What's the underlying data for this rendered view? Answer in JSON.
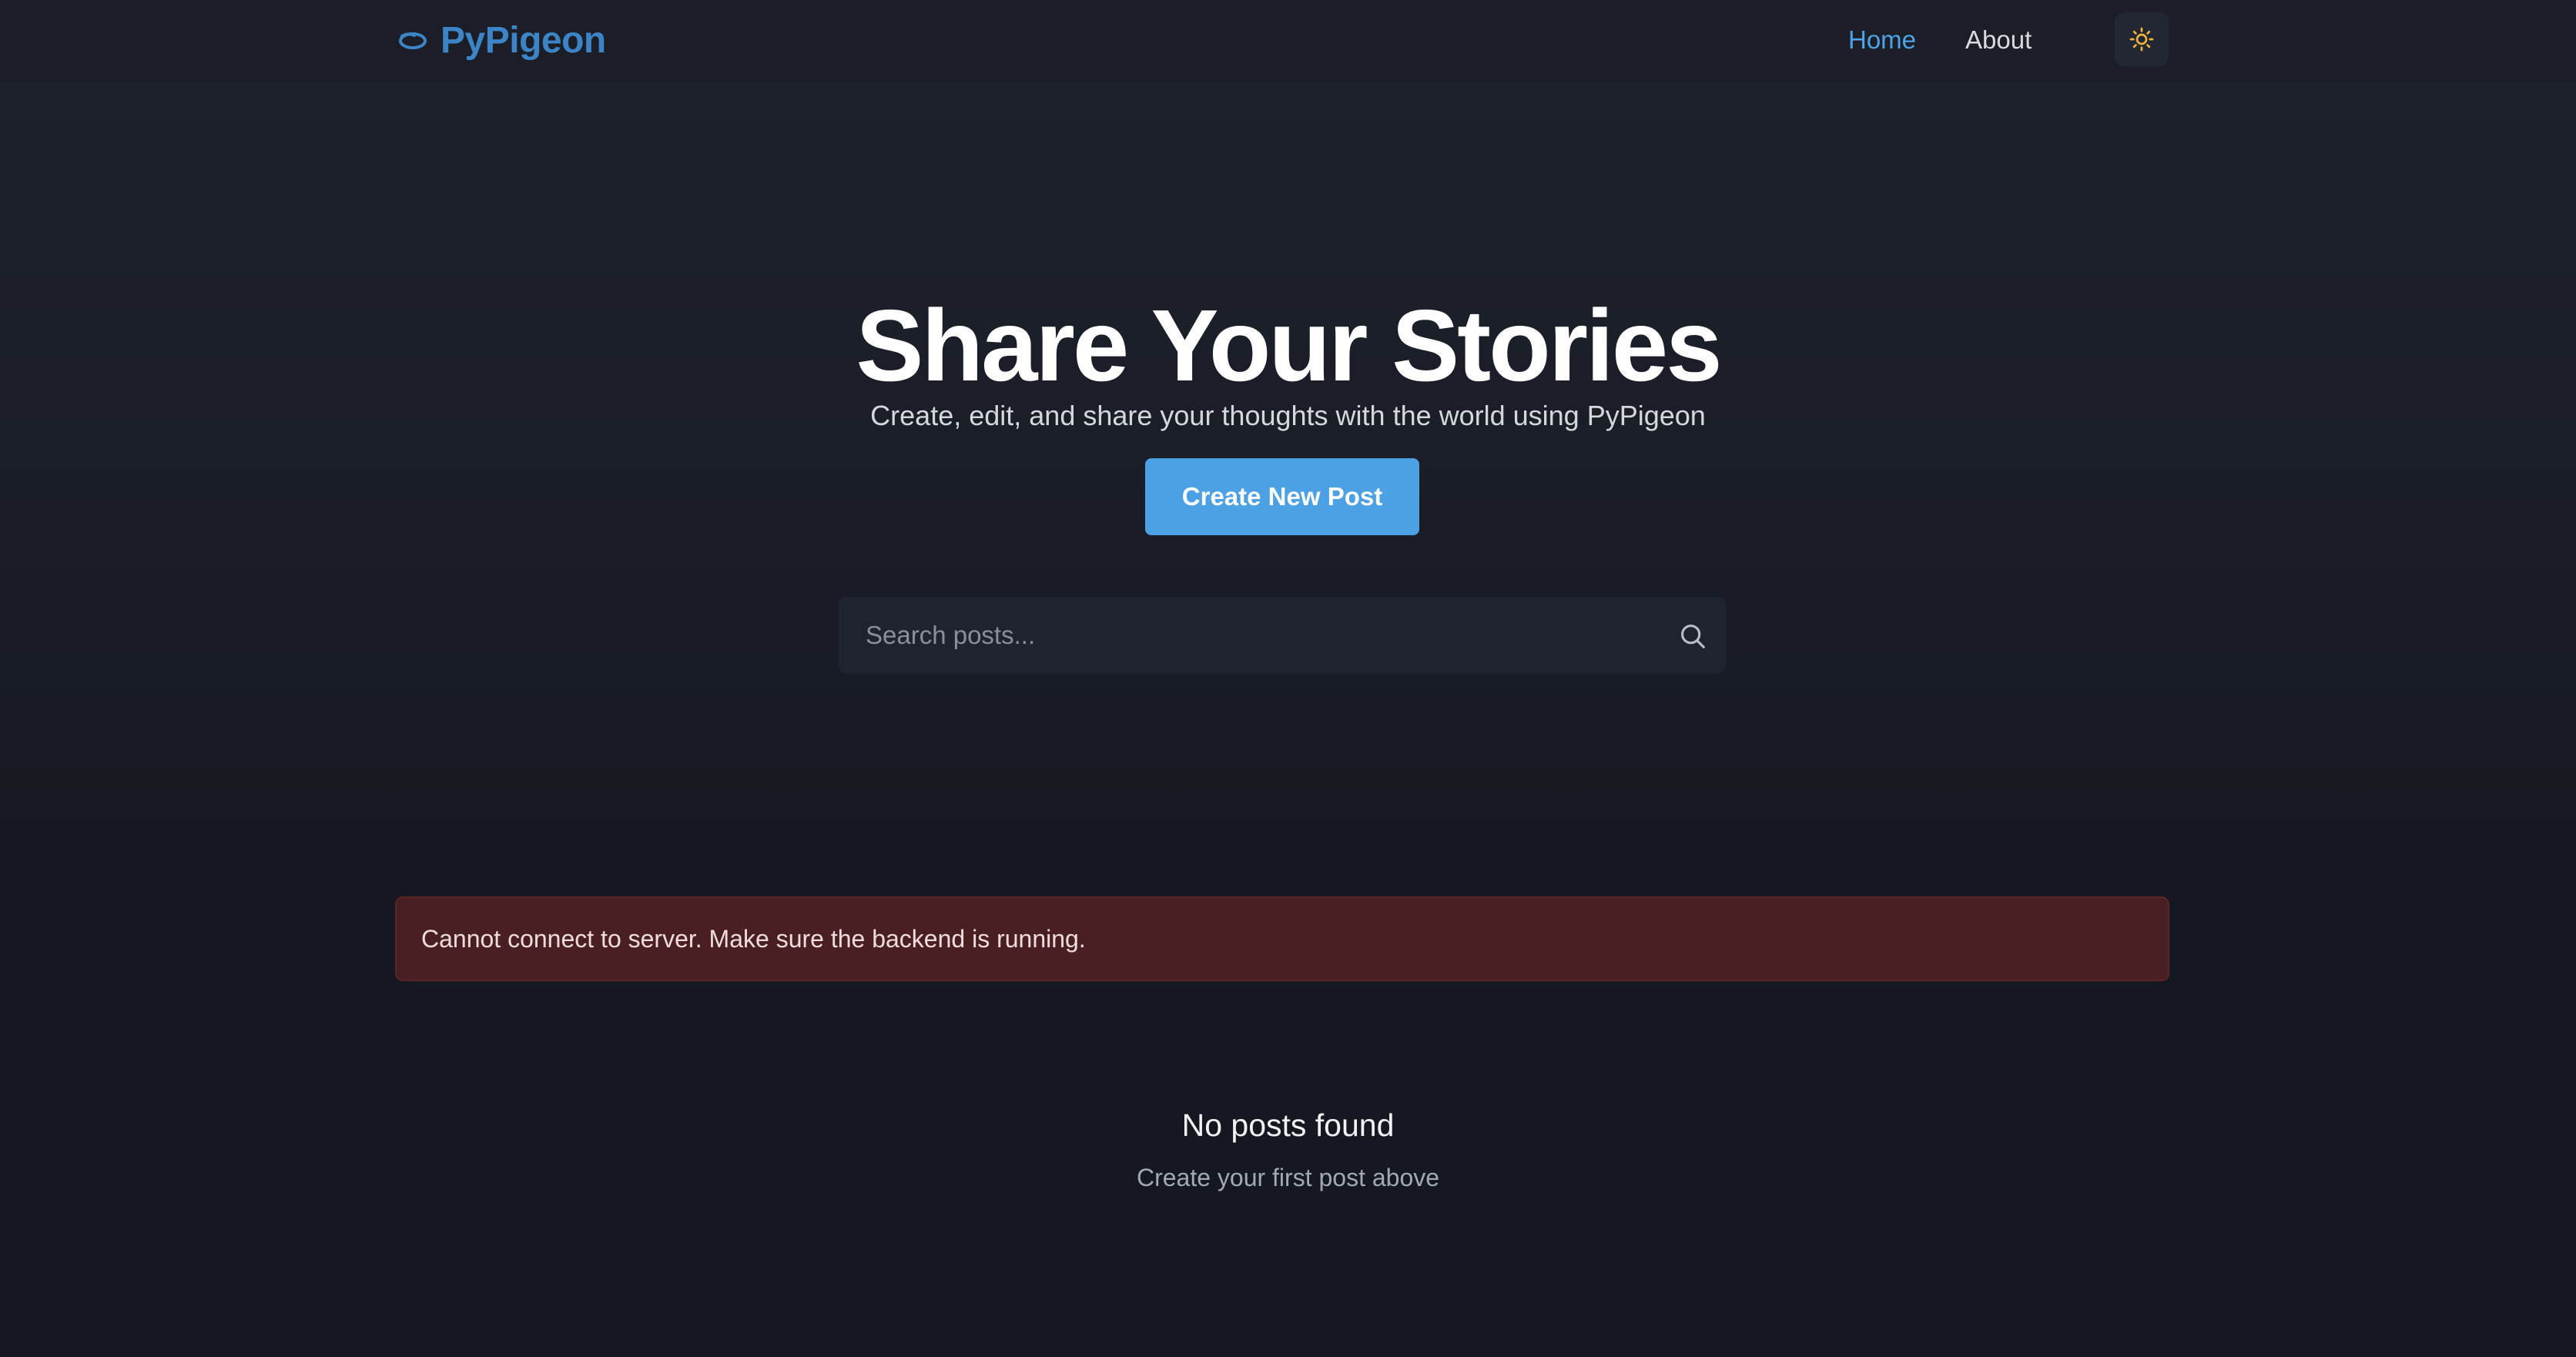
{
  "navbar": {
    "brand": "PyPigeon",
    "links": [
      {
        "label": "Home",
        "active": true
      },
      {
        "label": "About",
        "active": false
      }
    ],
    "theme_toggle_icon": "sun-icon"
  },
  "hero": {
    "title": "Share Your Stories",
    "subtitle": "Create, edit, and share your thoughts with the world using PyPigeon",
    "cta_label": "Create New Post"
  },
  "search": {
    "placeholder": "Search posts...",
    "value": "",
    "icon": "search-icon"
  },
  "alert": {
    "type": "error",
    "message": "Cannot connect to server. Make sure the backend is running."
  },
  "empty_state": {
    "title": "No posts found",
    "subtitle": "Create your first post above"
  },
  "colors": {
    "accent": "#4ba1e3",
    "brand": "#3d84c6",
    "background": "#151821",
    "error_bg": "#4a1f22",
    "sun": "#f0b43c"
  }
}
